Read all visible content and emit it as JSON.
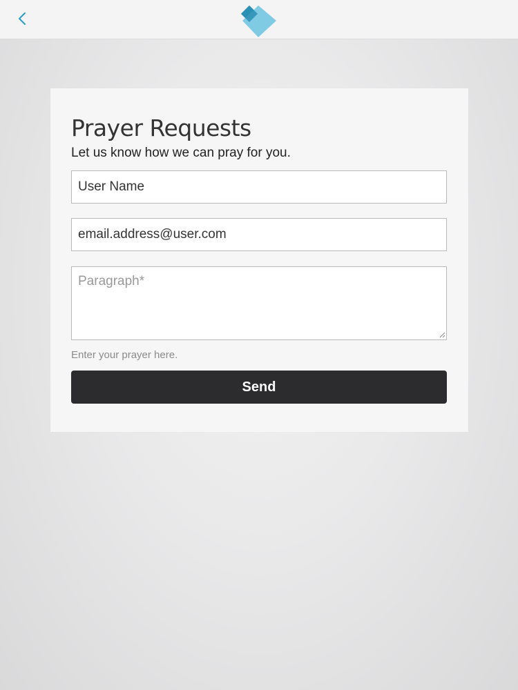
{
  "header": {
    "back_icon": "chevron-left-icon",
    "logo_icon": "heart-diamond-logo-icon",
    "accent_color": "#2a9cc8"
  },
  "form": {
    "title": "Prayer Requests",
    "subtitle": "Let us know how we can pray for you.",
    "name_field": {
      "value": "User Name"
    },
    "email_field": {
      "value": "email.address@user.com"
    },
    "paragraph_field": {
      "placeholder": "Paragraph*",
      "value": ""
    },
    "helper_text": "Enter your prayer here.",
    "send_label": "Send"
  }
}
